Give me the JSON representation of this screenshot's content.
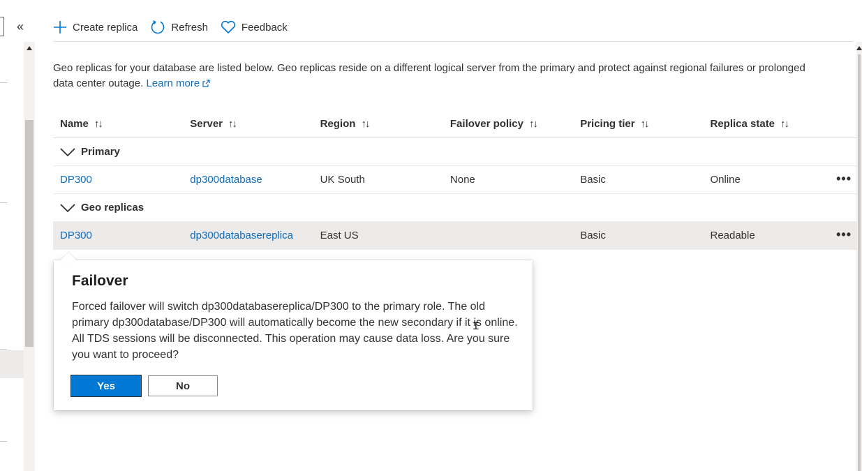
{
  "toolbar": {
    "create_replica": "Create replica",
    "refresh": "Refresh",
    "feedback": "Feedback"
  },
  "nav": {
    "collapse_glyph": "«"
  },
  "description": {
    "text": "Geo replicas for your database are listed below. Geo replicas reside on a different logical server from the primary and protect against regional failures or prolonged data center outage.",
    "learn_more": "Learn more"
  },
  "grid": {
    "headers": [
      "Name",
      "Server",
      "Region",
      "Failover policy",
      "Pricing tier",
      "Replica state"
    ],
    "sort_glyph": "↑↓",
    "groups": [
      {
        "label": "Primary",
        "rows": [
          {
            "name": "DP300",
            "server": "dp300database",
            "region": "UK South",
            "failover_policy": "None",
            "pricing_tier": "Basic",
            "replica_state": "Online"
          }
        ]
      },
      {
        "label": "Geo replicas",
        "rows": [
          {
            "name": "DP300",
            "server": "dp300databasereplica",
            "region": "East US",
            "failover_policy": "",
            "pricing_tier": "Basic",
            "replica_state": "Readable"
          }
        ]
      }
    ],
    "more_glyph": "•••"
  },
  "dialog": {
    "title": "Failover",
    "message": "Forced failover will switch dp300databasereplica/DP300 to the primary role. The old primary dp300database/DP300 will automatically become the new secondary if it is online. All TDS sessions will be disconnected. This operation may cause data loss. Are you sure you want to proceed?",
    "yes": "Yes",
    "no": "No"
  },
  "colors": {
    "accent": "#0078d4",
    "link": "#0f6cbd",
    "selected_row": "#edebe9"
  }
}
